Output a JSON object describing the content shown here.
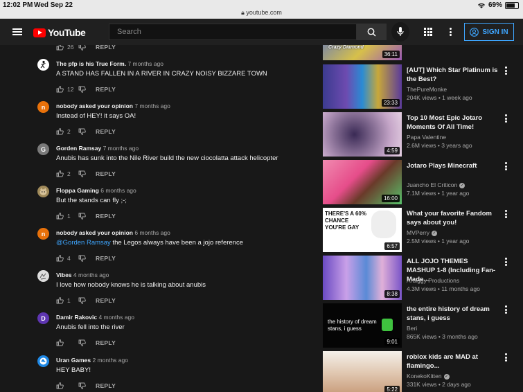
{
  "status": {
    "time": "12:02 PM",
    "date": "Wed Sep 22",
    "url": "youtube.com",
    "battery": "69%"
  },
  "header": {
    "logo_text": "YouTube",
    "search_placeholder": "Search",
    "signin_label": "SIGN IN",
    "accent": "#3ea6ff",
    "brand": "#ff0000"
  },
  "comments": [
    {
      "author": "",
      "time": "",
      "text": "",
      "likes": "26",
      "reply": "REPLY"
    },
    {
      "author": "The pfp is his True Form.",
      "time": "7 months ago",
      "text": "A STAND HAS FALLEN IN A RIVER IN CRAZY NOISY BIZZARE TOWN",
      "likes": "12",
      "reply": "REPLY"
    },
    {
      "author": "nobody asked your opinion",
      "time": "7 months ago",
      "text": "Instead of HEY! it says OA!",
      "likes": "2",
      "reply": "REPLY",
      "initial": "n"
    },
    {
      "author": "Gorden Ramsay",
      "time": "7 months ago",
      "text": "Anubis has sunk into the Nile River build the new ciocolatta attack helicopter",
      "likes": "2",
      "reply": "REPLY",
      "initial": "G"
    },
    {
      "author": "Floppa Gaming",
      "time": "6 months ago",
      "text": "But the stands can fly ;-;",
      "likes": "1",
      "reply": "REPLY"
    },
    {
      "author": "nobody asked your opinion",
      "time": "6 months ago",
      "mention": "@Gorden Ramsay",
      "text": " the Legos always have been a jojo reference",
      "likes": "4",
      "reply": "REPLY",
      "initial": "n"
    },
    {
      "author": "Vibes",
      "time": "4 months ago",
      "text": "I love how nobody knows he is talking about anubis",
      "likes": "1",
      "reply": "REPLY"
    },
    {
      "author": "Damir Rakovic",
      "time": "4 months ago",
      "text": "Anubis fell into the river",
      "likes": "",
      "reply": "REPLY",
      "initial": "D"
    },
    {
      "author": "Uran Games",
      "time": "2 months ago",
      "text": "HEY BABY!",
      "likes": "",
      "reply": "REPLY"
    }
  ],
  "videos": [
    {
      "title": "",
      "channel": "",
      "meta": "",
      "duration": "36:11",
      "thumb_text": "Crazy Diamond"
    },
    {
      "title": "[AUT] Which Star Platinum is the Best?",
      "channel": "ThePureMonke",
      "meta": "204K views • 1 week ago",
      "duration": "23:33"
    },
    {
      "title": "Top 10 Most Epic Jotaro Moments Of All Time!",
      "channel": "Papa Valentine",
      "meta": "2.6M views • 3 years ago",
      "duration": "4:59"
    },
    {
      "title": "Jotaro Plays Minecraft",
      "channel": "Juancho El Criticon",
      "meta": "7.1M views • 1 year ago",
      "duration": "16:00",
      "verified": true
    },
    {
      "title": "What your favorite Fandom says about you!",
      "channel": "MVPerry",
      "meta": "2.5M views • 1 year ago",
      "duration": "6:57",
      "verified": true,
      "thumb_text": "THERE'S A 60% CHANCE YOU'RE GAY"
    },
    {
      "title": "ALL JOJO THEMES MASHUP 1-8 (Including Fan-Made...",
      "channel": "Ardiggy Productions",
      "meta": "4.3M views • 11 months ago",
      "duration": "8:38"
    },
    {
      "title": "the entire history of dream stans, i guess",
      "channel": "Beri",
      "meta": "865K views • 3 months ago",
      "duration": "9:01",
      "thumb_text": "the history of dream stans, i guess"
    },
    {
      "title": "roblox kids are MAD at flamingo...",
      "channel": "KonekoKitten",
      "meta": "331K views • 2 days ago",
      "duration": "5:22",
      "verified": true
    }
  ]
}
